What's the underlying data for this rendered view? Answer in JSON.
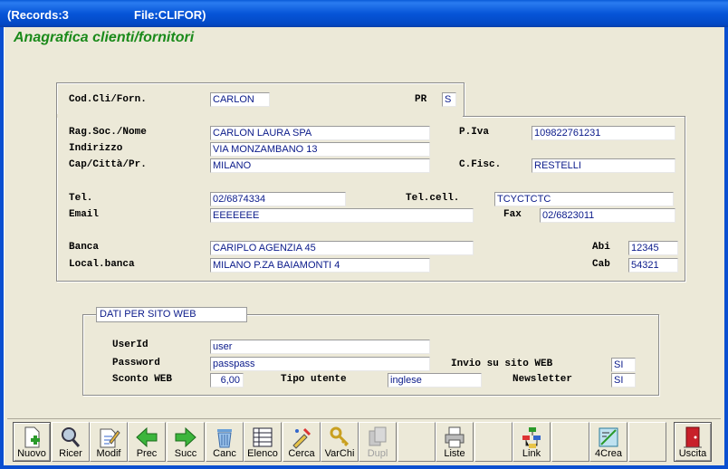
{
  "title": {
    "records": "(Records:3",
    "file": "File:CLIFOR)"
  },
  "form_title": "Anagrafica clienti/fornitori",
  "header": {
    "cod_label": "Cod.Cli/Forn.",
    "cod_value": "CARLON",
    "pr_label": "PR",
    "pr_value": "S"
  },
  "main": {
    "ragsoc_label": "Rag.Soc./Nome",
    "ragsoc_value": "CARLON LAURA SPA",
    "piva_label": "P.Iva",
    "piva_value": "109822761231",
    "indirizzo_label": "Indirizzo",
    "indirizzo_value": "VIA MONZAMBANO 13",
    "cap_label": "Cap/Città/Pr.",
    "cap_value": "MILANO",
    "cfisc_label": "C.Fisc.",
    "cfisc_value": "RESTELLI",
    "tel_label": "Tel.",
    "tel_value": "02/6874334",
    "telcell_label": "Tel.cell.",
    "telcell_value": "TCYCTCTC",
    "email_label": "Email",
    "email_value": "EEEEEEE",
    "fax_label": "Fax",
    "fax_value": "02/6823011",
    "banca_label": "Banca",
    "banca_value": "CARIPLO AGENZIA 45",
    "abi_label": "Abi",
    "abi_value": "12345",
    "localbanca_label": "Local.banca",
    "localbanca_value": "MILANO P.ZA BAIAMONTI 4",
    "cab_label": "Cab",
    "cab_value": "54321"
  },
  "web": {
    "legend": "DATI PER SITO WEB",
    "userid_label": "UserId",
    "userid_value": "user",
    "password_label": "Password",
    "password_value": "passpass",
    "invio_label": "Invio su sito WEB",
    "invio_value": "SI",
    "sconto_label": "Sconto WEB",
    "sconto_value": "6,00",
    "tipo_label": "Tipo utente",
    "tipo_value": "inglese",
    "newsletter_label": "Newsletter",
    "newsletter_value": "SI"
  },
  "toolbar": {
    "nuovo": "Nuovo",
    "ricer": "Ricer",
    "modif": "Modif",
    "prec": "Prec",
    "succ": "Succ",
    "canc": "Canc",
    "elenco": "Elenco",
    "cerca": "Cerca",
    "varchi": "VarChi",
    "dupl": "Dupl",
    "liste": "Liste",
    "link": "Link",
    "crea": "4Crea",
    "uscita": "Uscita"
  },
  "icons": [
    "add-doc-icon",
    "search-icon",
    "edit-doc-icon",
    "arrow-left-icon",
    "arrow-right-icon",
    "trash-icon",
    "list-icon",
    "cerca-icon",
    "keys-icon",
    "copy-icon",
    "printer-icon",
    "link-tree-icon",
    "crea-icon",
    "exit-door-icon"
  ],
  "colors": {
    "title_green": "#1a8a1a",
    "field_text": "#0a1a8a",
    "title_bar": "#0655d8"
  }
}
